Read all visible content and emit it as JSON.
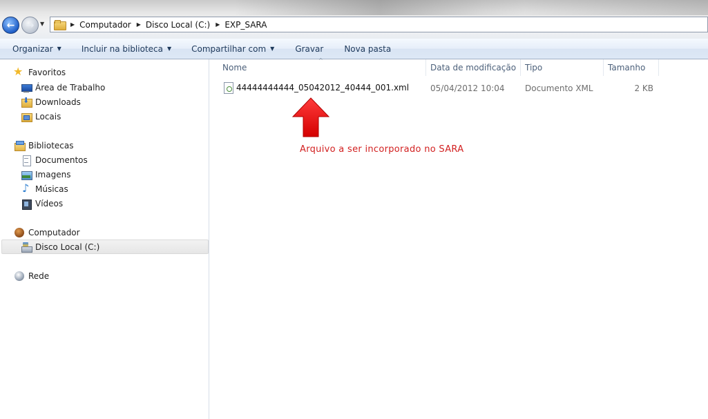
{
  "address": {
    "crumbs": [
      "Computador",
      "Disco Local (C:)",
      "EXP_SARA"
    ]
  },
  "toolbar": {
    "organize": "Organizar",
    "include_library": "Incluir na biblioteca",
    "share_with": "Compartilhar com",
    "burn": "Gravar",
    "new_folder": "Nova pasta"
  },
  "nav": {
    "favorites": {
      "label": "Favoritos",
      "items": [
        "Área de Trabalho",
        "Downloads",
        "Locais"
      ]
    },
    "libraries": {
      "label": "Bibliotecas",
      "items": [
        "Documentos",
        "Imagens",
        "Músicas",
        "Vídeos"
      ]
    },
    "computer": {
      "label": "Computador",
      "items": [
        "Disco Local (C:)"
      ]
    },
    "network": {
      "label": "Rede"
    }
  },
  "columns": [
    "Nome",
    "Data de modificação",
    "Tipo",
    "Tamanho"
  ],
  "files": [
    {
      "name": "44444444444_05042012_40444_001.xml",
      "modified": "05/04/2012 10:04",
      "type": "Documento XML",
      "size": "2 KB"
    }
  ],
  "annotation": "Arquivo a ser incorporado no SARA",
  "colors": {
    "annotation": "#d22020",
    "command_text": "#1e395b",
    "selected_bg": "#e9e9e9"
  }
}
